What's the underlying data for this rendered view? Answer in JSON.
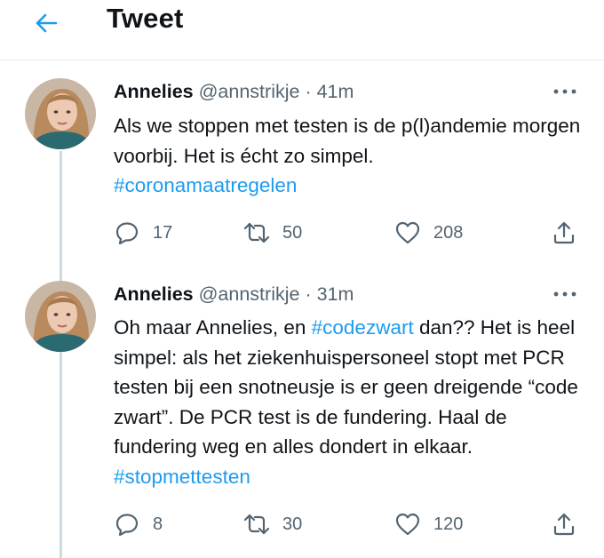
{
  "header": {
    "title": "Tweet",
    "back_icon": "arrow-left-icon"
  },
  "colors": {
    "accent": "#1d9bf0",
    "text": "#0f1419",
    "secondary": "#536471",
    "divider": "#e6ecf0",
    "thread_line": "#cfd9de"
  },
  "tweets": [
    {
      "name": "Annelies",
      "handle": "@annstrikje",
      "separator": "·",
      "time": "41m",
      "text_parts": {
        "line1": "Als we stoppen met testen is de p(l)andemie morgen voorbij. Het is écht zo simpel.",
        "hashtag1": "#coronamaatregelen"
      },
      "actions": {
        "replies": "17",
        "retweets": "50",
        "likes": "208"
      }
    },
    {
      "name": "Annelies",
      "handle": "@annstrikje",
      "separator": "·",
      "time": "31m",
      "text_parts": {
        "part1": "Oh maar Annelies, en ",
        "hashtag1": "#codezwart",
        "part2": " dan?? Het is heel simpel: als het ziekenhuispersoneel stopt met PCR testen bij een snotneusje is er geen dreigende “code zwart”. De PCR test is de fundering. Haal de fundering weg en alles dondert in elkaar. ",
        "hashtag2": "#stopmettesten"
      },
      "actions": {
        "replies": "8",
        "retweets": "30",
        "likes": "120"
      }
    }
  ]
}
